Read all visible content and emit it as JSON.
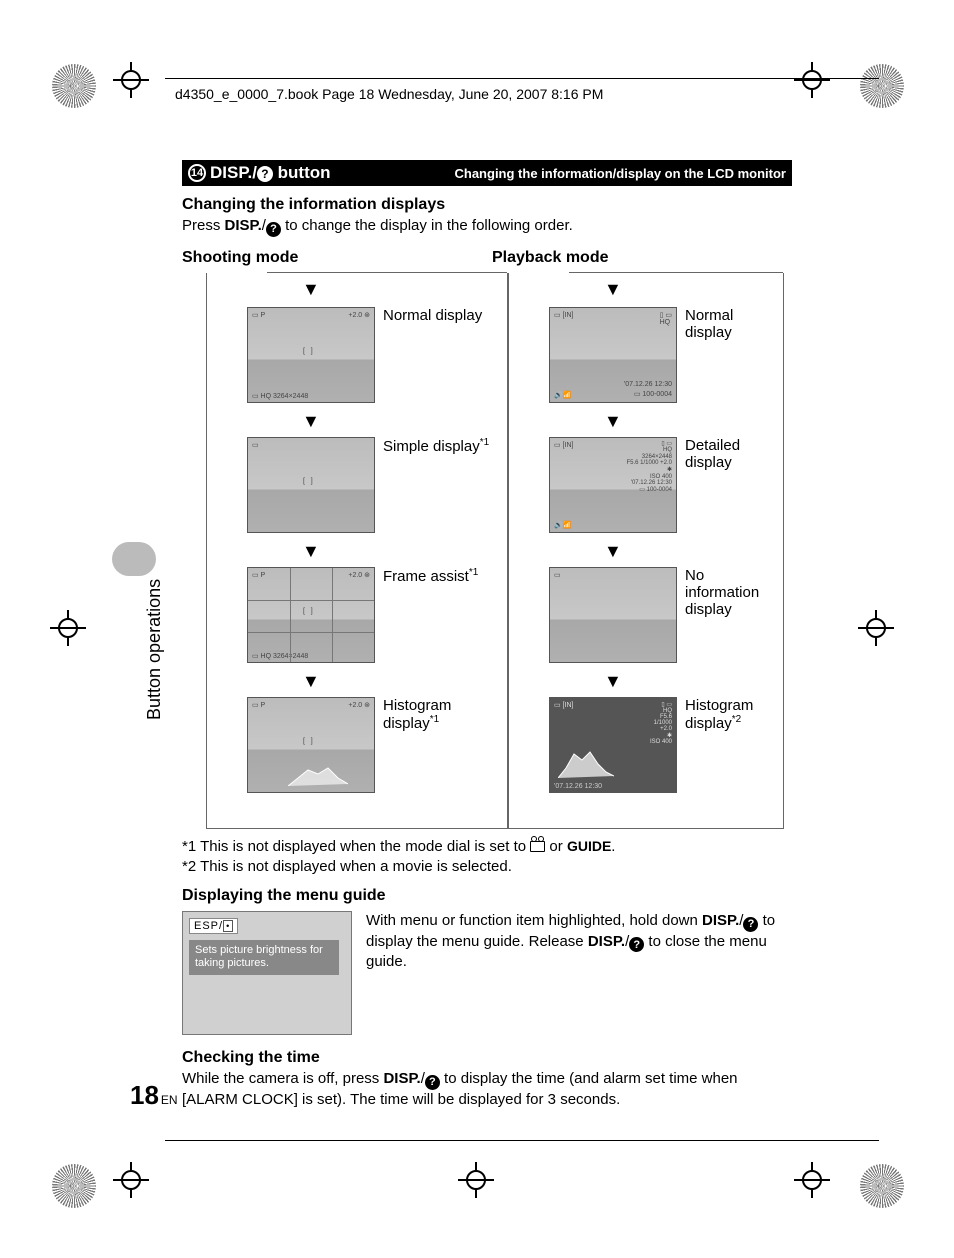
{
  "header": "d4350_e_0000_7.book  Page 18  Wednesday, June 20, 2007  8:16 PM",
  "banner": {
    "num": "14",
    "label_part1": "DISP./",
    "label_qmark": "?",
    "label_part2": " button",
    "right": "Changing the information/display on the LCD monitor"
  },
  "sec1": {
    "heading": "Changing the information displays",
    "line_part1": "Press ",
    "line_bold": "DISP.",
    "line_slash": "/",
    "line_part2": " to change the display in the following order."
  },
  "modes": {
    "shooting": "Shooting mode",
    "playback": "Playback mode"
  },
  "shooting_labels": {
    "r1": "Normal display",
    "r2": "Simple display",
    "r2_sup": "*1",
    "r3": "Frame assist",
    "r3_sup": "*1",
    "r4": "Histogram display",
    "r4_sup": "*1"
  },
  "playback_labels": {
    "r1": "Normal display",
    "r2": "Detailed display",
    "r3": "No information display",
    "r4": "Histogram display",
    "r4_sup": "*2"
  },
  "notes": {
    "n1_prefix": "*1 This is not displayed when the mode dial is set to ",
    "n1_or": " or ",
    "n1_guide": "GUIDE",
    "n1_dot": ".",
    "n2": "*2 This is not displayed when a movie is selected."
  },
  "sec2": {
    "heading": "Displaying the menu guide",
    "chip": "ESP/",
    "desc": "Sets picture brightness for taking pictures.",
    "para_a": "With menu or function item highlighted, hold down ",
    "para_b": " to display the menu guide. Release ",
    "para_c": " to close the menu guide."
  },
  "sec3": {
    "heading": "Checking the time",
    "para_a": "While the camera is off, press ",
    "para_b": " to display the time (and alarm set time when [ALARM CLOCK] is set). The time will be displayed for 3 seconds."
  },
  "sidebar": "Button operations",
  "page": {
    "num": "18",
    "lang": "EN"
  },
  "disp_bold": "DISP.",
  "slash": "/"
}
